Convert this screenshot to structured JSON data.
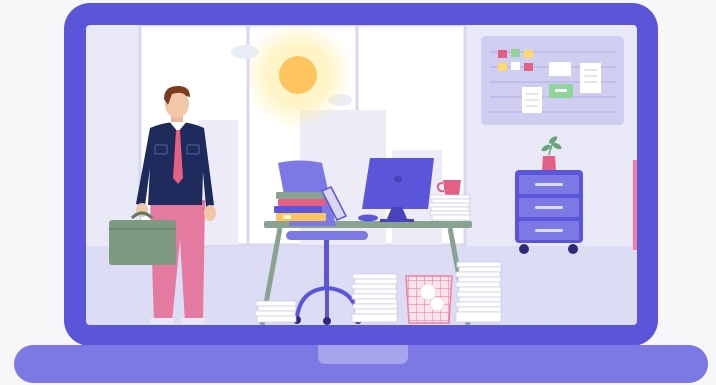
{
  "illustration": {
    "subject": "laptop-office-scene",
    "colors": {
      "laptop_frame": "#5b55d9",
      "laptop_base": "#7c78e4",
      "laptop_notch": "#a7a4ee",
      "screen_bg": "#e9e8f7",
      "floor": "#dcdcf5",
      "sun": "#fdc45f",
      "glow": "#fff0b0",
      "desk": "#8aa391",
      "monitor": "#5b55d9",
      "mug": "#e35f84",
      "briefcase": "#7e9b82",
      "shirt": "#1f2a5c",
      "pants": "#e57aa0",
      "tie": "#e35f84",
      "cabinet": "#5b55d9",
      "board": "#cfcdf0",
      "paper": "#ffffff",
      "paper_edge": "#c9c8e2",
      "basket": "#f07fa2"
    },
    "icons": [
      "laptop-icon",
      "sun-icon",
      "businessman-icon",
      "briefcase-icon",
      "office-chair-icon",
      "desk-icon",
      "computer-monitor-icon",
      "coffee-mug-icon",
      "book-stack-icon",
      "paper-stack-icon",
      "trash-basket-icon",
      "filing-cabinet-icon",
      "plant-vase-icon",
      "notice-board-icon"
    ]
  }
}
